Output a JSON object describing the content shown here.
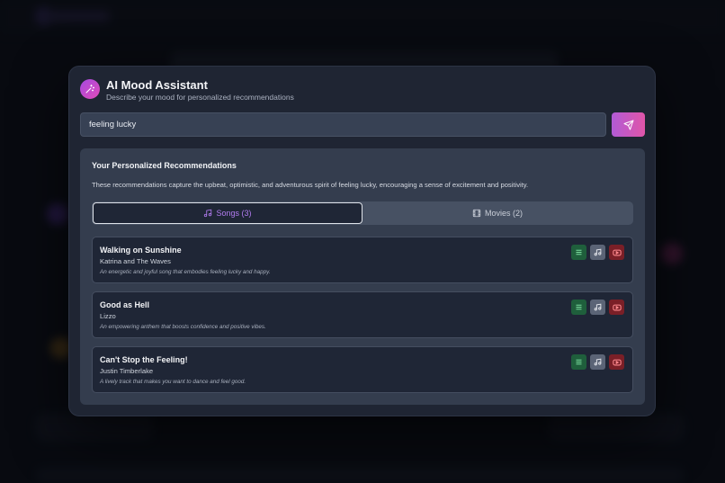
{
  "modal": {
    "title": "AI Mood Assistant",
    "subtitle": "Describe your mood for personalized recommendations",
    "icon": "magic-wand-icon"
  },
  "search": {
    "value": "feeling lucky",
    "send_icon": "send-icon"
  },
  "recommendations": {
    "title": "Your Personalized Recommendations",
    "description": "These recommendations capture the upbeat, optimistic, and adventurous spirit of feeling lucky, encouraging a sense of excitement and positivity."
  },
  "tabs": [
    {
      "label": "Songs (3)",
      "icon": "music-note-icon",
      "active": true
    },
    {
      "label": "Movies (2)",
      "icon": "film-icon",
      "active": false
    }
  ],
  "songs": [
    {
      "title": "Walking on Sunshine",
      "artist": "Katrina and The Waves",
      "description": "An energetic and joyful song that embodies feeling lucky and happy."
    },
    {
      "title": "Good as Hell",
      "artist": "Lizzo",
      "description": "An empowering anthem that boosts confidence and positive vibes."
    },
    {
      "title": "Can't Stop the Feeling!",
      "artist": "Justin Timberlake",
      "description": "A lively track that makes you want to dance and feel good."
    }
  ],
  "colors": {
    "accent": "#b27cf0",
    "list_button": "#1f5f3c",
    "music_button": "#5b6476",
    "video_button": "#7a1f27"
  }
}
